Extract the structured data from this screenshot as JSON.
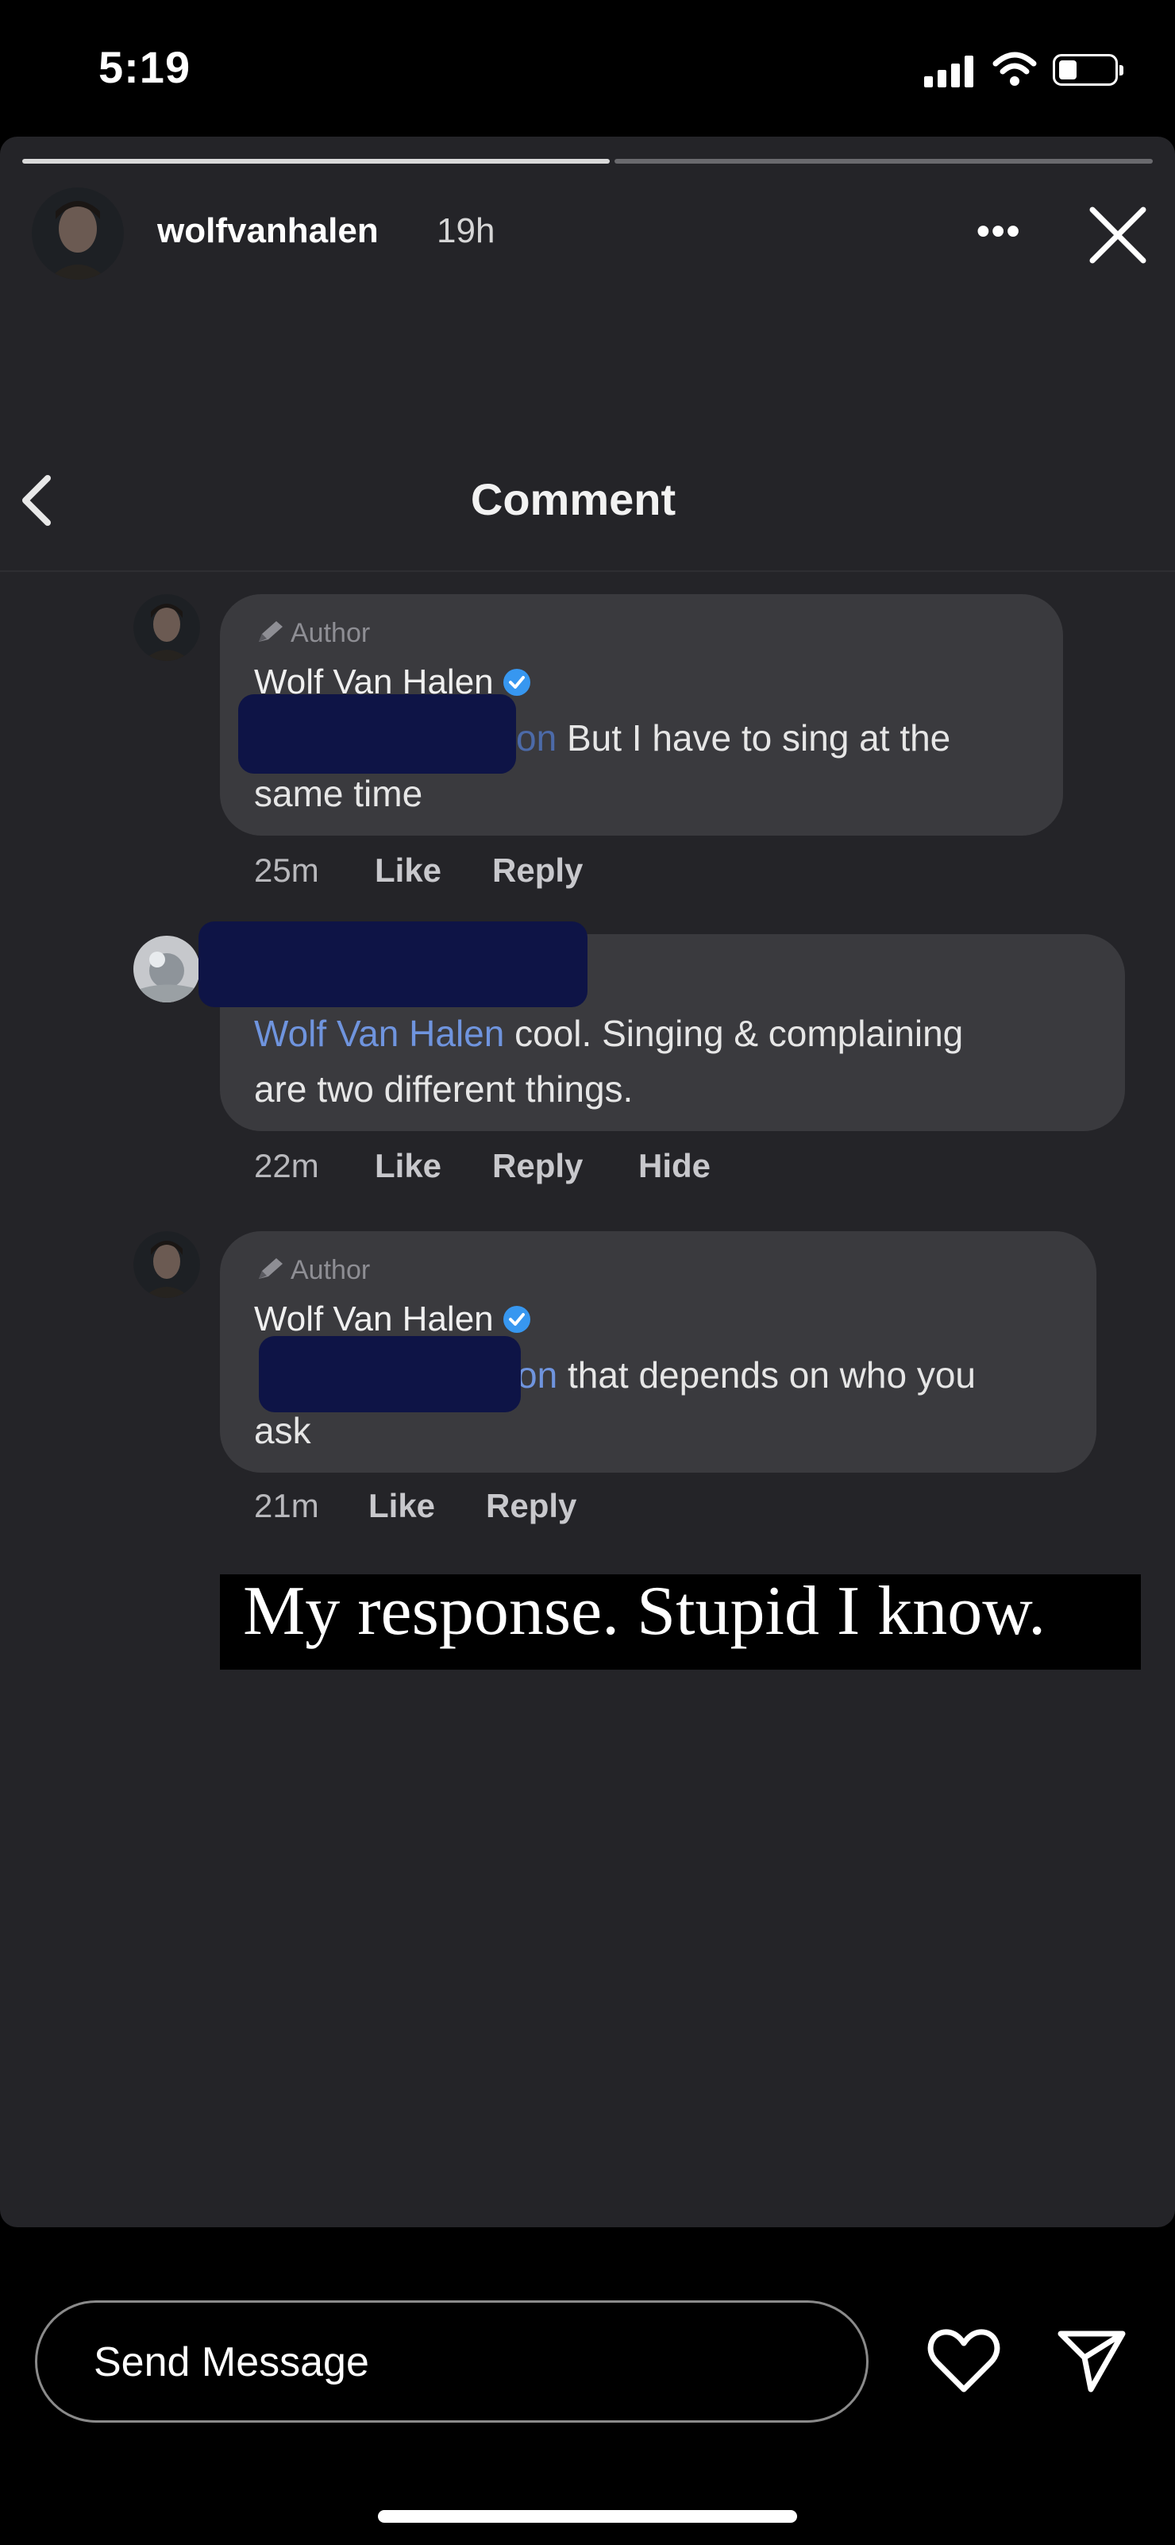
{
  "status_bar": {
    "time": "5:19"
  },
  "story": {
    "username": "wolfvanhalen",
    "age": "19h",
    "more_glyph": "•••",
    "progress_fraction": 0.52
  },
  "comments_header": {
    "title": "Comment"
  },
  "comments": [
    {
      "author_tag": "Author",
      "name": "Wolf Van Halen",
      "mention_fragment": "on",
      "text_line1": " But I have to sing at the",
      "text_line2": "same time",
      "time": "25m",
      "actions": [
        "Like",
        "Reply"
      ]
    },
    {
      "mention": "Wolf Van Halen",
      "text_line1": " cool. Singing & complaining",
      "text_line2": "are two different things.",
      "time": "22m",
      "actions": [
        "Like",
        "Reply",
        "Hide"
      ]
    },
    {
      "author_tag": "Author",
      "name": "Wolf Van Halen",
      "mention_fragment": "son",
      "text_line1": " that depends on who you",
      "text_line2": "ask",
      "time": "21m",
      "actions": [
        "Like",
        "Reply"
      ]
    }
  ],
  "caption": "My response. Stupid I know.",
  "reply_bar": {
    "placeholder": "Send Message"
  },
  "colors": {
    "card": "#242428",
    "bubble": "#3a3a3e",
    "mention": "#6f94de",
    "verified": "#3797f0"
  },
  "icons": [
    "signal-icon",
    "wifi-icon",
    "battery-icon",
    "more-icon",
    "close-icon",
    "back-chevron-icon",
    "pencil-icon",
    "verified-badge-icon",
    "heart-icon",
    "send-icon"
  ]
}
